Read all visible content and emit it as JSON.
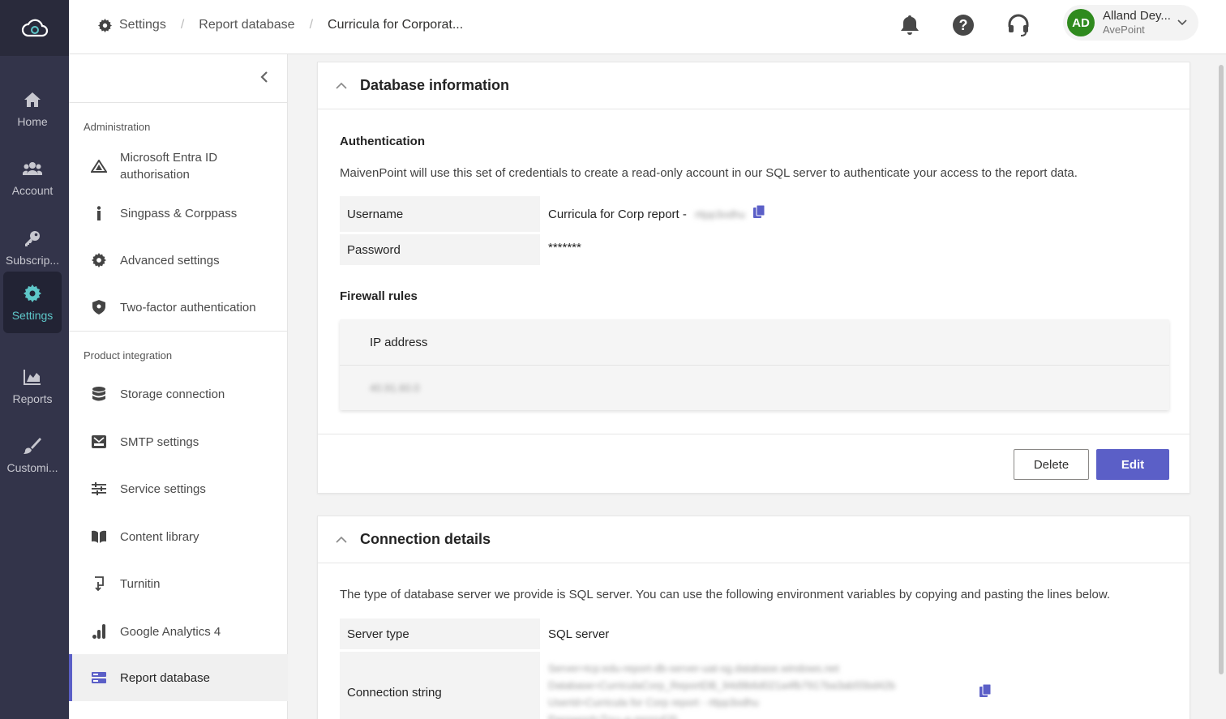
{
  "rail": {
    "items": [
      {
        "label": "Home",
        "icon": "home-icon"
      },
      {
        "label": "Account",
        "icon": "people-icon"
      },
      {
        "label": "Subscrip...",
        "icon": "key-icon"
      },
      {
        "label": "Settings",
        "icon": "gear-icon",
        "active": true
      },
      {
        "label": "Reports",
        "icon": "chart-icon"
      },
      {
        "label": "Customi...",
        "icon": "brush-icon"
      }
    ]
  },
  "breadcrumb": {
    "items": [
      "Settings",
      "Report database",
      "Curricula for Corporat..."
    ]
  },
  "user": {
    "initials": "AD",
    "name": "Alland Dey...",
    "org": "AvePoint"
  },
  "nav": {
    "sections": [
      {
        "title": "Administration",
        "items": [
          {
            "label": "Microsoft Entra ID authorisation",
            "icon": "entra-icon"
          },
          {
            "label": "Singpass & Corppass",
            "icon": "info-icon"
          },
          {
            "label": "Advanced settings",
            "icon": "gear-icon"
          },
          {
            "label": "Two-factor authentication",
            "icon": "shield-icon"
          }
        ]
      },
      {
        "title": "Product integration",
        "items": [
          {
            "label": "Storage connection",
            "icon": "database-icon"
          },
          {
            "label": "SMTP settings",
            "icon": "mail-tray-icon"
          },
          {
            "label": "Service settings",
            "icon": "sliders-icon"
          },
          {
            "label": "Content library",
            "icon": "book-icon"
          },
          {
            "label": "Turnitin",
            "icon": "turnitin-icon"
          },
          {
            "label": "Google Analytics 4",
            "icon": "analytics-icon"
          },
          {
            "label": "Report database",
            "icon": "server-icon",
            "active": true
          }
        ]
      }
    ]
  },
  "database_info": {
    "title": "Database information",
    "auth_title": "Authentication",
    "auth_desc": "MaivenPoint will use this set of credentials to create a read-only account in our SQL server to authenticate your access to the report data.",
    "username_label": "Username",
    "username_value": "Curricula for Corp report -",
    "username_suffix": "rttpp3odhu",
    "password_label": "Password",
    "password_value": "*******",
    "firewall_title": "Firewall rules",
    "firewall_header": "IP address",
    "firewall_rows": [
      "40.91.60.0"
    ],
    "delete_label": "Delete",
    "edit_label": "Edit"
  },
  "connection": {
    "title": "Connection details",
    "desc": "The type of database server we provide is SQL server. You can use the following environment variables by copying and pasting the lines below.",
    "server_type_label": "Server type",
    "server_type_value": "SQL server",
    "conn_label": "Connection string",
    "conn_lines": [
      "Server=tcp:edu-report-db-server-uat-sg.database.windows.net",
      "Database=CurriculaCorp_ReportDB_94d9b6d021a4fb7917ba3ab55bd42b",
      "UserId=Curricula for Corp report - rttpp3odhu",
      "Password=Trx+-e-mrrrrvfJS"
    ]
  },
  "colors": {
    "accent": "#5b5fc7",
    "rail_bg": "#33344a",
    "settings_active": "#5ec7c9",
    "avatar": "#2f8a1e"
  }
}
